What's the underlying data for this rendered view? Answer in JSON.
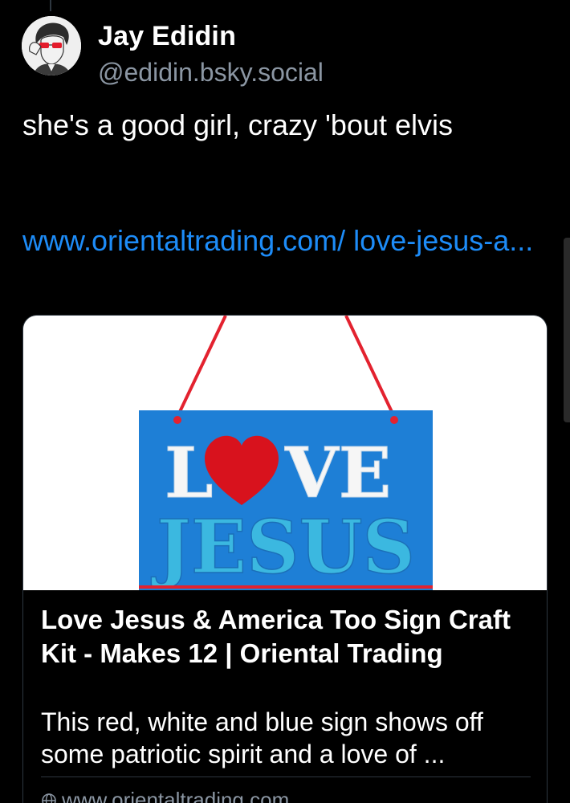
{
  "post": {
    "author_name": "Jay Edidin",
    "author_handle": "@edidin.bsky.social",
    "text": "she's a good girl, crazy 'bout elvis",
    "link_text": "www.orientaltrading.com/ love-jesus-a..."
  },
  "link_card": {
    "image_text_top": "L VE",
    "image_text_bottom": "JESUS",
    "title": "Love Jesus & America Too Sign Craft Kit - Makes 12 | Oriental Trading",
    "description": "This red, white and blue sign shows off some patriotic spirit and a love of ...",
    "domain": "www.orientaltrading.com",
    "icon": "globe-icon"
  },
  "colors": {
    "background": "#000000",
    "link": "#1d8cf8",
    "muted": "#8b96a3",
    "sign_blue": "#1e7fd6",
    "heart_red": "#d8121d"
  }
}
